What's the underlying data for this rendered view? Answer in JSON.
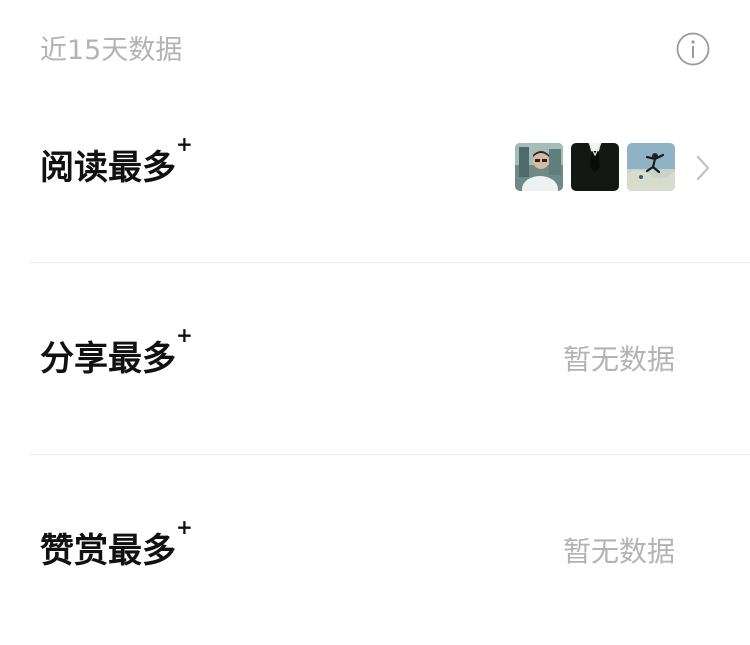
{
  "header": {
    "title": "近15天数据",
    "info_icon": "info-circle-icon"
  },
  "rows": [
    {
      "label": "阅读最多",
      "plus": "+",
      "has_thumbnails": true,
      "thumbnails": [
        "portrait-photo",
        "suit-tie-image",
        "skydiver-photo"
      ],
      "chevron_icon": "chevron-right-icon"
    },
    {
      "label": "分享最多",
      "plus": "+",
      "empty_text": "暂无数据"
    },
    {
      "label": "赞赏最多",
      "plus": "+",
      "empty_text": "暂无数据"
    }
  ],
  "colors": {
    "muted_text": "#b3b3b3",
    "primary_text": "#111111",
    "divider": "#ececec"
  }
}
